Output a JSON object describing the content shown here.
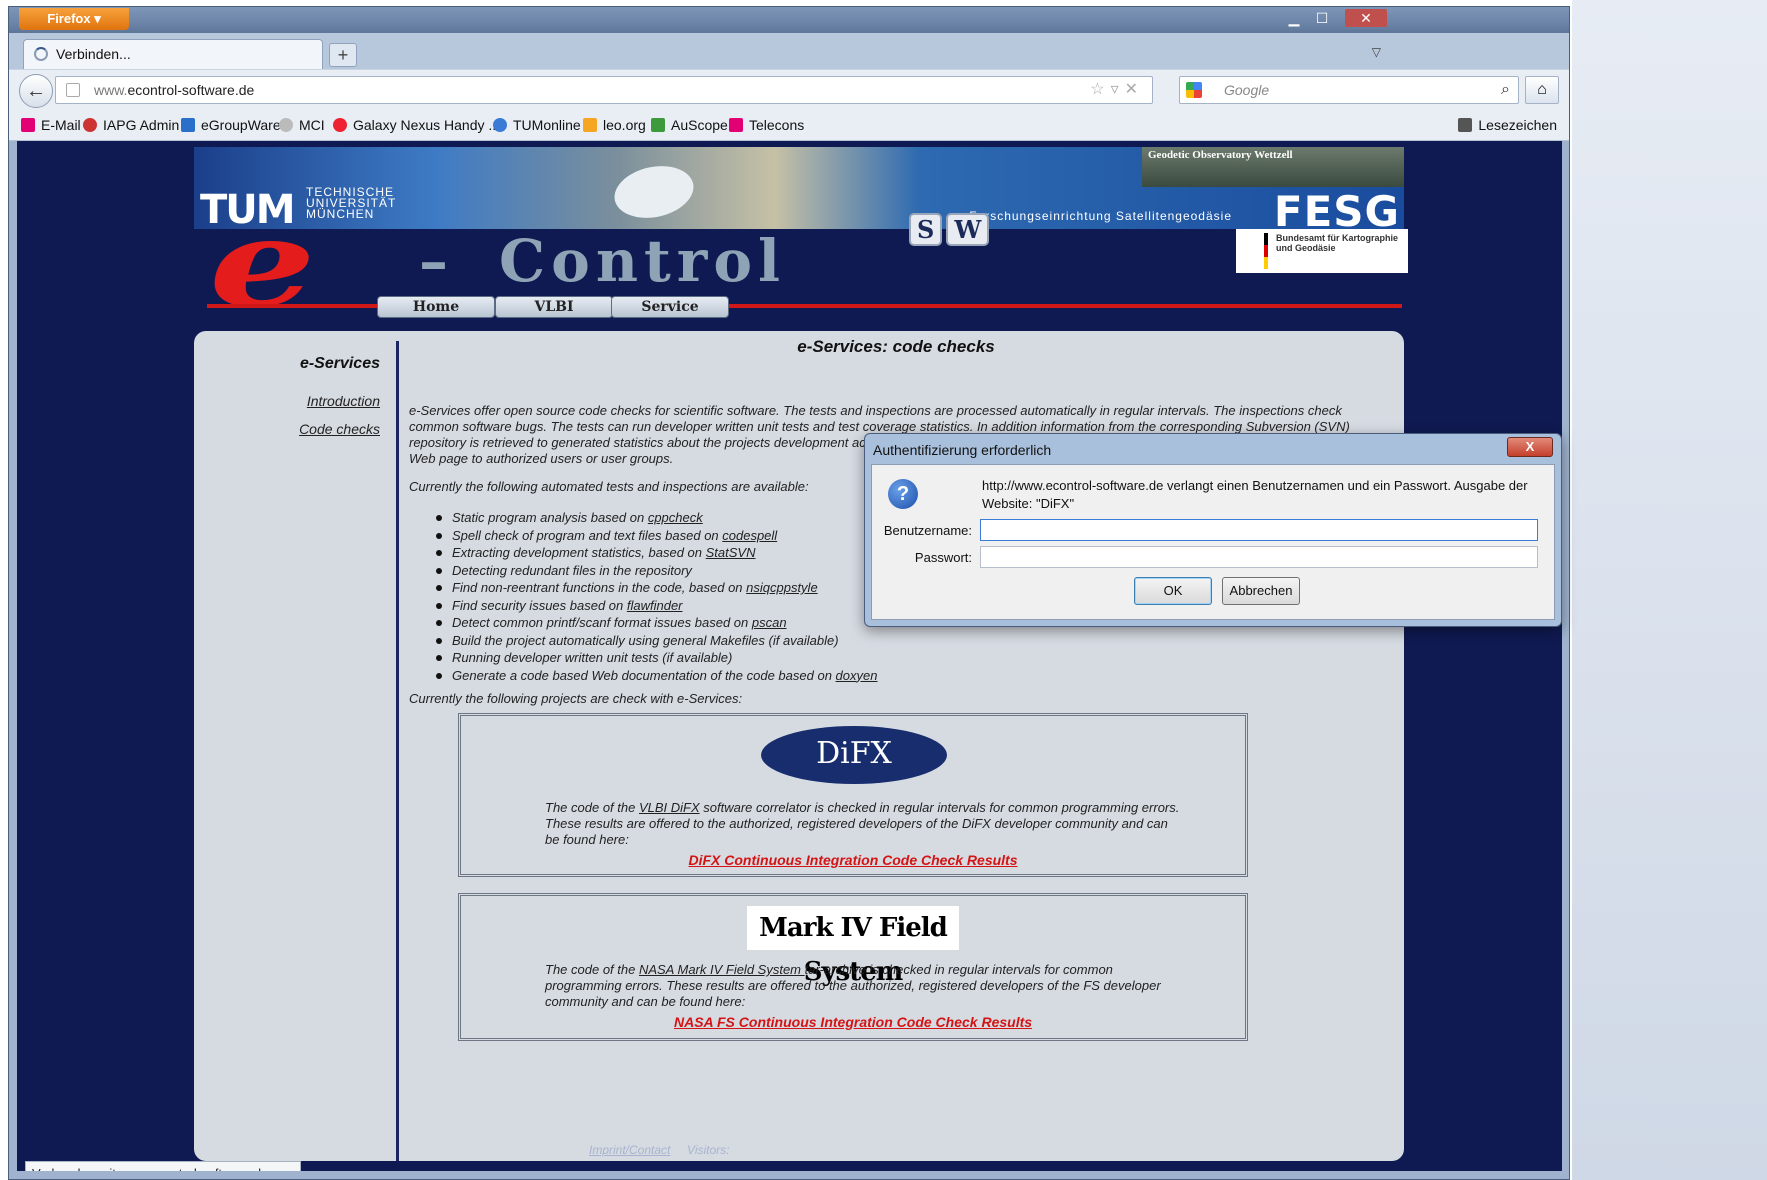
{
  "browser": {
    "app_button": "Firefox",
    "tab_title": "Verbinden...",
    "new_tab": "+",
    "url_prefix": "www.",
    "url_host": "econtrol-software.de",
    "search_placeholder": "Google",
    "bookmarks": [
      "E-Mail",
      "IAPG Admin",
      "eGroupWare",
      "MCI",
      "Galaxy Nexus Handy ...",
      "TUMonline",
      "leo.org",
      "AuScope",
      "Telecons"
    ],
    "bookmarks_menu": "Lesezeichen",
    "status": "Verbunden mit www.econtrol-software.de..."
  },
  "header": {
    "tum_logo": "TUM",
    "tum_text": "TECHNISCHE UNIVERSITÄT MÜNCHEN",
    "fesg_caption": "Forschungseinrichtung Satellitengeodäsie",
    "fesg_logo": "FESG",
    "observatory": "Geodetic Observatory Wettzell",
    "bkg": "Bundesamt für Kartographie und Geodäsie",
    "e_letter": "e",
    "dash": "–",
    "control": "Control",
    "sw": [
      "S",
      "W"
    ],
    "nav": [
      "Home",
      "VLBI",
      "Service"
    ]
  },
  "sidebar": {
    "title": "e-Services",
    "links": [
      "Introduction",
      "Code checks"
    ]
  },
  "main": {
    "title": "e-Services: code checks",
    "intro": "e-Services offer open source code checks for scientific software. The tests and inspections are processed automatically in regular intervals. The inspections check common software bugs. The tests can run developer written unit tests and test coverage statistics. In addition information from the corresponding Subversion (SVN) repository is retrieved to generated statistics about the projects development activities. The corresponding results are automatically converted to HTML and offered via this Web page to authorized users or user groups.",
    "tests_intro": "Currently the following automated tests and inspections are available:",
    "bullets": [
      {
        "text": "Static program analysis based on ",
        "link": "cppcheck"
      },
      {
        "text": "Spell check of program and text files based on ",
        "link": "codespell"
      },
      {
        "text": "Extracting development statistics, based on ",
        "link": "StatSVN"
      },
      {
        "text": "Detecting redundant files in the repository",
        "link": ""
      },
      {
        "text": "Find non-reentrant functions in the code, based on ",
        "link": "nsiqcppstyle"
      },
      {
        "text": "Find security issues based on ",
        "link": "flawfinder"
      },
      {
        "text": "Detect common printf/scanf format issues based on ",
        "link": "pscan"
      },
      {
        "text": "Build the project automatically using general Makefiles (if available)",
        "link": ""
      },
      {
        "text": "Running developer written unit tests (if available)",
        "link": ""
      },
      {
        "text": "Generate a code based Web documentation of the code based on ",
        "link": "doxyen"
      }
    ],
    "projects_intro": "Currently the following projects are check with e-Services:",
    "difx": {
      "logo": "DiFX",
      "text_pre": "The code of the ",
      "text_link": "VLBI DiFX",
      "text_post": " software correlator is checked in regular intervals for common programming errors. These results are offered to the authorized, registered developers of the DiFX developer community and can be found here:",
      "result_link": "DiFX Continuous Integration Code Check Results"
    },
    "markiv": {
      "logo": "Mark IV Field System",
      "text_pre": "The code of the ",
      "text_link": "NASA Mark IV Field System ",
      "text_post": "tar-archive is checked in regular intervals for common programming errors. These results are offered to the authorized, registered developers of the FS developer community and can be found here:",
      "result_link": "NASA FS Continuous Integration Code Check Results"
    }
  },
  "footer": {
    "imprint": "Imprint/Contact",
    "visitors": "Visitors:"
  },
  "dialog": {
    "title": "Authentifizierung erforderlich",
    "close": "X",
    "message": "http://www.econtrol-software.de verlangt einen Benutzernamen und ein Passwort. Ausgabe der Website: \"DiFX\"",
    "username_label": "Benutzername:",
    "username_value": "",
    "password_label": "Passwort:",
    "password_value": "",
    "ok": "OK",
    "cancel": "Abbrechen"
  }
}
